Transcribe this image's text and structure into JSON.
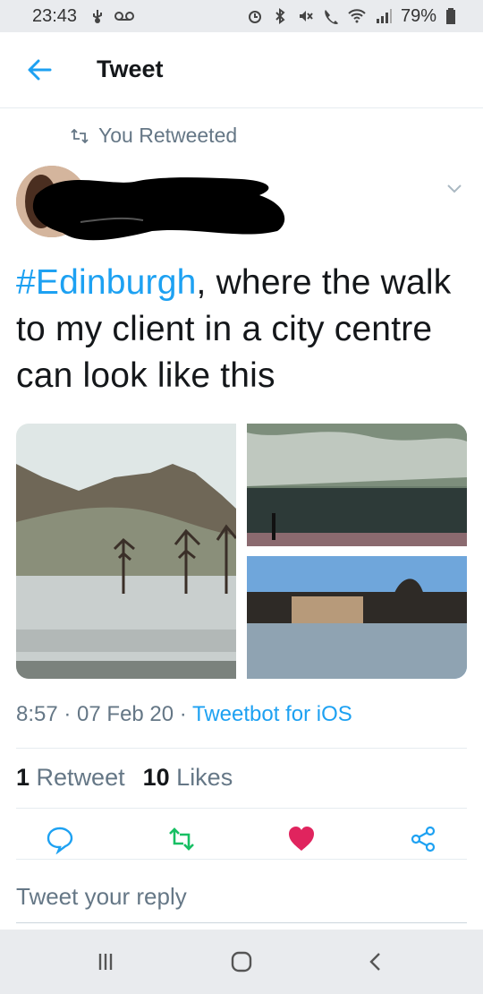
{
  "status_bar": {
    "time": "23:43",
    "battery": "79%",
    "icons": [
      "usb-icon",
      "voicemail-icon",
      "alarm-icon",
      "bluetooth-icon",
      "mute-icon",
      "call-icon",
      "wifi-icon",
      "signal-icon",
      "battery-icon"
    ]
  },
  "header": {
    "title": "Tweet",
    "back_icon": "arrow-left-icon"
  },
  "tweet": {
    "retweeted_label": "You Retweeted",
    "hashtag": "#Edinburgh",
    "text": ", where the walk to my client in a city centre can look like this",
    "timestamp": "8:57 · 07 Feb 20 · ",
    "client": "Tweetbot for iOS",
    "retweet_count": "1",
    "retweet_label": "Retweet",
    "like_count": "10",
    "like_label": "Likes"
  },
  "reply": {
    "placeholder": "Tweet your reply"
  },
  "colors": {
    "accent": "#1da1f2",
    "retweet_green": "#17bf63",
    "like_red": "#e0245e",
    "muted": "#657786"
  }
}
